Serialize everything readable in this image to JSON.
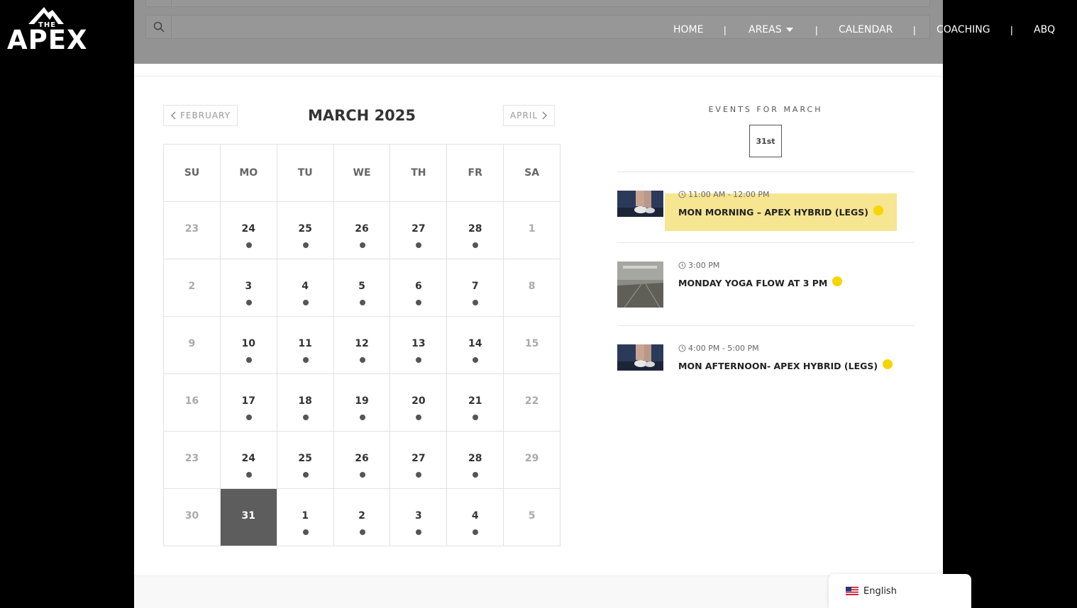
{
  "brand": {
    "top": "THE",
    "name": "APEX"
  },
  "nav": {
    "items": [
      {
        "label": "HOME",
        "has_dropdown": false
      },
      {
        "label": "AREAS",
        "has_dropdown": true
      },
      {
        "label": "CALENDAR",
        "has_dropdown": false
      },
      {
        "label": "COACHING",
        "has_dropdown": false
      },
      {
        "label": "ABQ",
        "has_dropdown": false
      }
    ],
    "separator": "|"
  },
  "search": {
    "icon": "search-icon"
  },
  "calendar": {
    "title": "MARCH 2025",
    "prev_label": "FEBRUARY",
    "next_label": "APRIL",
    "weekdays": [
      "SU",
      "MO",
      "TU",
      "WE",
      "TH",
      "FR",
      "SA"
    ],
    "weeks": [
      [
        {
          "day": "23",
          "muted": true,
          "event": false
        },
        {
          "day": "24",
          "muted": false,
          "event": true
        },
        {
          "day": "25",
          "muted": false,
          "event": true
        },
        {
          "day": "26",
          "muted": false,
          "event": true
        },
        {
          "day": "27",
          "muted": false,
          "event": true
        },
        {
          "day": "28",
          "muted": false,
          "event": true
        },
        {
          "day": "1",
          "muted": true,
          "event": false
        }
      ],
      [
        {
          "day": "2",
          "muted": true,
          "event": false
        },
        {
          "day": "3",
          "muted": false,
          "event": true
        },
        {
          "day": "4",
          "muted": false,
          "event": true
        },
        {
          "day": "5",
          "muted": false,
          "event": true
        },
        {
          "day": "6",
          "muted": false,
          "event": true
        },
        {
          "day": "7",
          "muted": false,
          "event": true
        },
        {
          "day": "8",
          "muted": true,
          "event": false
        }
      ],
      [
        {
          "day": "9",
          "muted": true,
          "event": false
        },
        {
          "day": "10",
          "muted": false,
          "event": true
        },
        {
          "day": "11",
          "muted": false,
          "event": true
        },
        {
          "day": "12",
          "muted": false,
          "event": true
        },
        {
          "day": "13",
          "muted": false,
          "event": true
        },
        {
          "day": "14",
          "muted": false,
          "event": true
        },
        {
          "day": "15",
          "muted": true,
          "event": false
        }
      ],
      [
        {
          "day": "16",
          "muted": true,
          "event": false
        },
        {
          "day": "17",
          "muted": false,
          "event": true
        },
        {
          "day": "18",
          "muted": false,
          "event": true
        },
        {
          "day": "19",
          "muted": false,
          "event": true
        },
        {
          "day": "20",
          "muted": false,
          "event": true
        },
        {
          "day": "21",
          "muted": false,
          "event": true
        },
        {
          "day": "22",
          "muted": true,
          "event": false
        }
      ],
      [
        {
          "day": "23",
          "muted": true,
          "event": false
        },
        {
          "day": "24",
          "muted": false,
          "event": true
        },
        {
          "day": "25",
          "muted": false,
          "event": true
        },
        {
          "day": "26",
          "muted": false,
          "event": true
        },
        {
          "day": "27",
          "muted": false,
          "event": true
        },
        {
          "day": "28",
          "muted": false,
          "event": true
        },
        {
          "day": "29",
          "muted": true,
          "event": false
        }
      ],
      [
        {
          "day": "30",
          "muted": true,
          "event": false
        },
        {
          "day": "31",
          "muted": false,
          "event": false,
          "selected": true
        },
        {
          "day": "1",
          "muted": false,
          "event": true
        },
        {
          "day": "2",
          "muted": false,
          "event": true
        },
        {
          "day": "3",
          "muted": false,
          "event": true
        },
        {
          "day": "4",
          "muted": false,
          "event": true
        },
        {
          "day": "5",
          "muted": true,
          "event": false
        }
      ]
    ]
  },
  "events": {
    "heading": "EVENTS FOR MARCH",
    "day_label": "31st",
    "items": [
      {
        "time": "11:00 AM - 12:00 PM",
        "title": "MON MORNING – APEX HYBRID (LEGS)",
        "thumb": "gym-shoes",
        "highlighted": true
      },
      {
        "time": "3:00 PM",
        "title": "MONDAY YOGA FLOW AT 3 PM",
        "thumb": "empty-studio",
        "highlighted": false
      },
      {
        "time": "4:00 PM - 5:00 PM",
        "title": "MON AFTERNOON- APEX HYBRID (LEGS)",
        "thumb": "gym-shoes",
        "highlighted": false
      }
    ],
    "dot_color": "#f5d600",
    "highlight_color": "#f6e591"
  },
  "language": {
    "label": "English",
    "flag": "us-flag-icon"
  }
}
